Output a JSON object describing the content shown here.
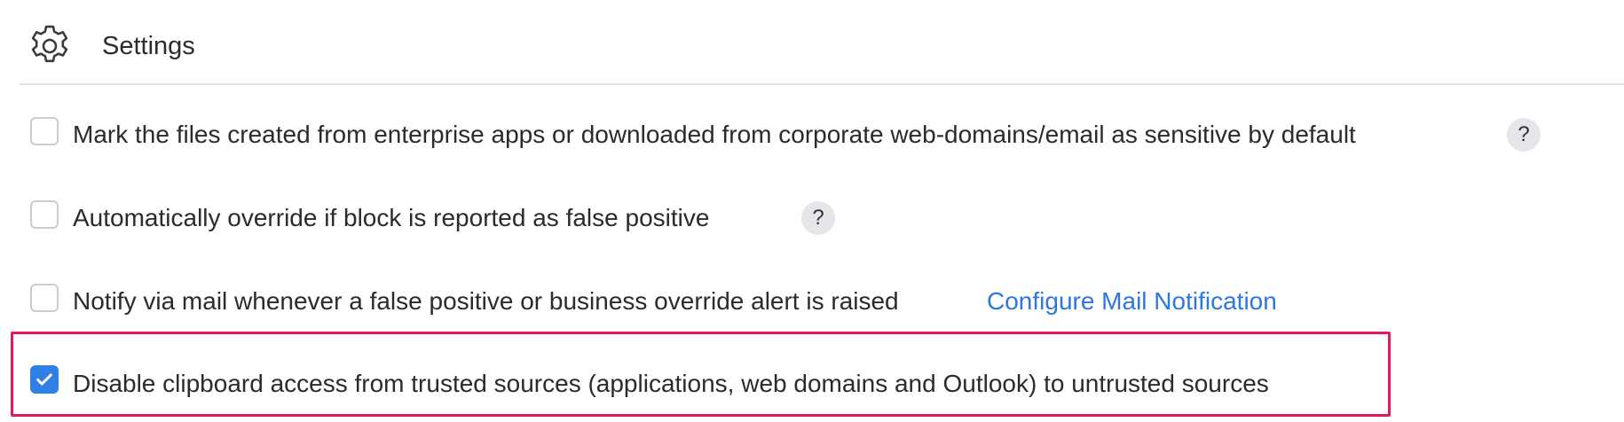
{
  "header": {
    "title": "Settings",
    "icon": "gear-icon"
  },
  "options": [
    {
      "label": "Mark the files created from enterprise apps or downloaded from corporate web-domains/email as sensitive by default",
      "checked": false,
      "help": "?"
    },
    {
      "label": "Automatically override if block is reported as false positive",
      "checked": false,
      "help": "?"
    },
    {
      "label": "Notify via mail whenever a false positive or business override alert is raised",
      "checked": false,
      "link": "Configure Mail Notification"
    },
    {
      "label": "Disable clipboard access from trusted sources (applications, web domains and Outlook) to untrusted sources",
      "checked": true
    }
  ],
  "colors": {
    "accent": "#2f80e6",
    "link": "#2f77e0",
    "highlight_border": "#e5175d"
  }
}
